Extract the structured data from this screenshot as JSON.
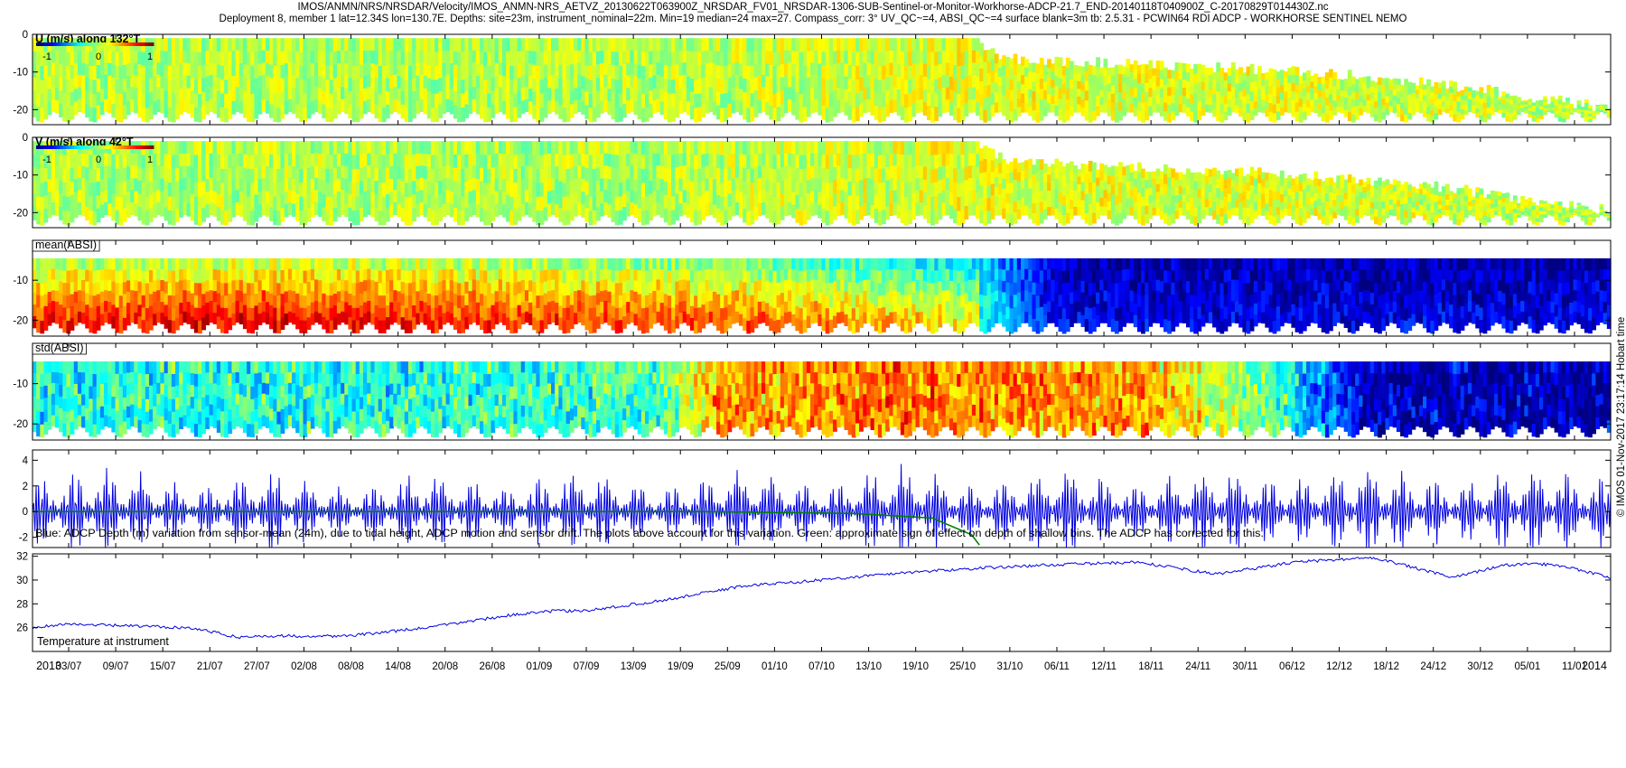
{
  "header": {
    "title_line1": "IMOS/ANMN/NRS/NRSDAR/Velocity/IMOS_ANMN-NRS_AETVZ_20130622T063900Z_NRSDAR_FV01_NRSDAR-1306-SUB-Sentinel-or-Monitor-Workhorse-ADCP-21.7_END-20140118T040900Z_C-20170829T014430Z.nc",
    "title_line2": "Deployment 8, member 1 lat=12.34S lon=130.7E. Depths: site=23m, instrument_nominal=22m. Min=19 median=24 max=27. Compass_corr: 3° UV_QC~=4, ABSI_QC~=4 surface blank=3m tb: 2.5.31 - PCWIN64 RDI ADCP - WORKHORSE SENTINEL NEMO"
  },
  "credit": "© IMOS 01-Nov-2017 23:17:14 Hobart time",
  "colors": {
    "blue_line": "#0000e0",
    "green_line": "#008000",
    "jet_low": "#00008f",
    "jet_mid": "#33cc33",
    "jet_high": "#800000"
  },
  "chart_data": [
    {
      "type": "heatmap",
      "label": "U (m/s) along 132°T",
      "colorbar_ticks": [
        "-1",
        "0",
        "1"
      ],
      "clim": [
        -1.2,
        1.2
      ],
      "ylim": [
        -24,
        0
      ],
      "yticks": [
        "0",
        "-10",
        "-20"
      ],
      "value_profile": {
        "x": [
          0,
          0.4,
          0.6,
          0.9,
          1.0
        ],
        "level": [
          0.55,
          0.55,
          0.6,
          0.58,
          0.55
        ]
      },
      "shallow_valid_limit": {
        "x": [
          0,
          0.6,
          0.62,
          0.8,
          0.9,
          1.0
        ],
        "depth": [
          -1,
          -1,
          -5,
          -8,
          -12,
          -18
        ]
      }
    },
    {
      "type": "heatmap",
      "label": "V (m/s) along 42°T",
      "colorbar_ticks": [
        "-1",
        "0",
        "1"
      ],
      "clim": [
        -1.2,
        1.2
      ],
      "ylim": [
        -24,
        0
      ],
      "yticks": [
        "0",
        "-10",
        "-20"
      ],
      "value_profile": {
        "x": [
          0,
          0.4,
          0.6,
          0.9,
          1.0
        ],
        "level": [
          0.55,
          0.55,
          0.6,
          0.58,
          0.55
        ]
      },
      "shallow_valid_limit": {
        "x": [
          0,
          0.6,
          0.62,
          0.8,
          0.9,
          1.0
        ],
        "depth": [
          -1,
          -1,
          -5,
          -8,
          -12,
          -18
        ]
      }
    },
    {
      "type": "heatmap",
      "label": "mean(ABSI)",
      "ylim": [
        -24,
        0
      ],
      "yticks": [
        "-10",
        "-20"
      ],
      "value_profile": {
        "x": [
          0,
          0.15,
          0.3,
          0.45,
          0.6,
          0.65,
          0.75,
          1.0
        ],
        "level": [
          0.55,
          0.6,
          0.55,
          0.5,
          0.35,
          0.05,
          0.05,
          0.05
        ]
      }
    },
    {
      "type": "heatmap",
      "label": "std(ABSI)",
      "ylim": [
        -24,
        0
      ],
      "yticks": [
        "-10",
        "-20"
      ],
      "value_profile": {
        "x": [
          0,
          0.25,
          0.4,
          0.43,
          0.55,
          0.63,
          0.7,
          0.78,
          0.85,
          1.0
        ],
        "level": [
          0.4,
          0.4,
          0.45,
          0.7,
          0.78,
          0.72,
          0.72,
          0.5,
          0.05,
          0.05
        ]
      }
    },
    {
      "type": "line",
      "label": "Blue: ADCP Depth (m) variation from sensor-mean (24m), due to tidal height, ADCP motion and sensor drift. The plots above account for this variation. Green: approximate sign of effect on depth of shallow bins. The ADCP has corrected for this.",
      "ylim": [
        -2.8,
        4.8
      ],
      "yticks": [
        "4",
        "2",
        "0",
        "-2"
      ],
      "series": [
        {
          "name": "Blue",
          "envelope": {
            "x": [
              0,
              0.05,
              0.1,
              0.15,
              0.2,
              0.25,
              0.3,
              0.35,
              0.4,
              0.45,
              0.5,
              0.55,
              0.6,
              0.65,
              0.7,
              0.75,
              0.8,
              0.85,
              0.9,
              0.95,
              1.0
            ],
            "amplitude": [
              2.5,
              3.3,
              1.8,
              3.2,
              1.7,
              3.2,
              1.8,
              3.3,
              1.7,
              3.5,
              1.8,
              3.6,
              2.0,
              3.5,
              2.1,
              3.3,
              2.4,
              3.6,
              2.1,
              3.5,
              2.5
            ]
          }
        },
        {
          "name": "Green",
          "x": [
            0,
            0.42,
            0.46,
            0.52,
            0.57,
            0.595,
            0.6
          ],
          "y": [
            0,
            0,
            -0.05,
            -0.15,
            -0.5,
            -1.8,
            -2.6
          ]
        }
      ]
    },
    {
      "type": "line",
      "label": "Temperature at instrument",
      "ylim": [
        24,
        32.2
      ],
      "yticks": [
        "32",
        "30",
        "28",
        "26"
      ],
      "series": [
        {
          "name": "Temperature",
          "x": [
            0,
            0.02,
            0.1,
            0.13,
            0.15,
            0.2,
            0.25,
            0.3,
            0.33,
            0.35,
            0.4,
            0.45,
            0.5,
            0.55,
            0.6,
            0.65,
            0.7,
            0.75,
            0.8,
            0.85,
            0.9,
            0.93,
            0.95,
            0.97,
            1.0
          ],
          "y": [
            26,
            26.3,
            26.0,
            25.2,
            25.3,
            25.3,
            26.0,
            27.0,
            27.4,
            27.4,
            28.3,
            29.5,
            30.0,
            30.6,
            31.0,
            31.3,
            31.5,
            30.5,
            31.5,
            31.9,
            30.2,
            31.2,
            31.4,
            31.2,
            30.2
          ]
        }
      ]
    }
  ],
  "xaxis": {
    "year_labels": [
      {
        "label": "2013",
        "x": 0.0
      },
      {
        "label": "2014",
        "x": 1.0
      }
    ],
    "ticks": [
      "03/07",
      "09/07",
      "15/07",
      "21/07",
      "27/07",
      "02/08",
      "08/08",
      "14/08",
      "20/08",
      "26/08",
      "01/09",
      "07/09",
      "13/09",
      "19/09",
      "25/09",
      "01/10",
      "07/10",
      "13/10",
      "19/10",
      "25/10",
      "31/10",
      "06/11",
      "12/11",
      "18/11",
      "24/11",
      "30/11",
      "06/12",
      "12/12",
      "18/12",
      "24/12",
      "30/12",
      "05/01",
      "11/01"
    ]
  }
}
